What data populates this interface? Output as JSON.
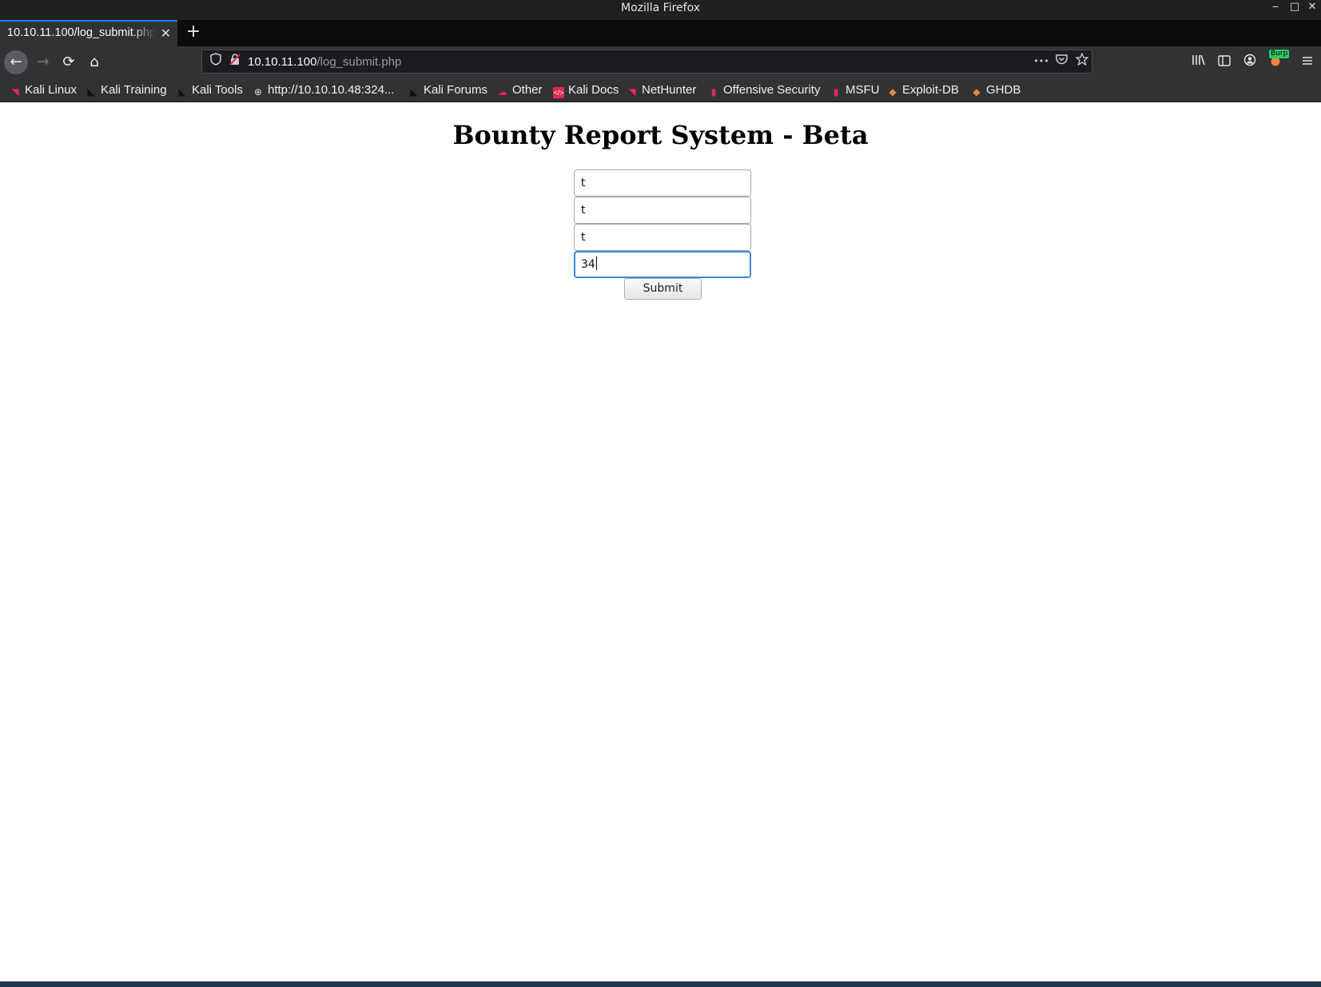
{
  "window": {
    "title": "Mozilla Firefox",
    "controls": {
      "minimize": "‒",
      "maximize": "□",
      "close": "✕"
    }
  },
  "tabs": [
    {
      "title": "10.10.11.100/log_submit.php",
      "close": "✕"
    }
  ],
  "new_tab_label": "+",
  "nav": {
    "back": "←",
    "forward": "→",
    "reload": "⟳",
    "home": "⌂"
  },
  "urlbar": {
    "host": "10.10.11.100",
    "path": "/log_submit.php",
    "more": "•••"
  },
  "toolbar": {
    "burp_badge": "Burp"
  },
  "bookmarks": [
    {
      "label": "Kali Linux",
      "icon": "kali-dragon-icon"
    },
    {
      "label": "Kali Training",
      "icon": "kali-dragon-icon"
    },
    {
      "label": "Kali Tools",
      "icon": "kali-dragon-icon"
    },
    {
      "label": "http://10.10.10.48:324...",
      "icon": "globe-icon"
    },
    {
      "label": "Kali Forums",
      "icon": "kali-dragon-icon"
    },
    {
      "label": "Other",
      "icon": "cloud-icon"
    },
    {
      "label": "Kali Docs",
      "icon": "docs-icon"
    },
    {
      "label": "NetHunter",
      "icon": "nethunter-icon"
    },
    {
      "label": "Offensive Security",
      "icon": "offsec-icon"
    },
    {
      "label": "MSFU",
      "icon": "offsec-icon"
    },
    {
      "label": "Exploit-DB",
      "icon": "exploitdb-icon"
    },
    {
      "label": "GHDB",
      "icon": "exploitdb-icon"
    }
  ],
  "page": {
    "title": "Bounty Report System - Beta",
    "fields": [
      "t",
      "t",
      "t",
      "34"
    ],
    "submit_label": "Submit"
  },
  "colors": {
    "accent": "#0a84ff",
    "focus_ring": "#3d8ad6"
  }
}
